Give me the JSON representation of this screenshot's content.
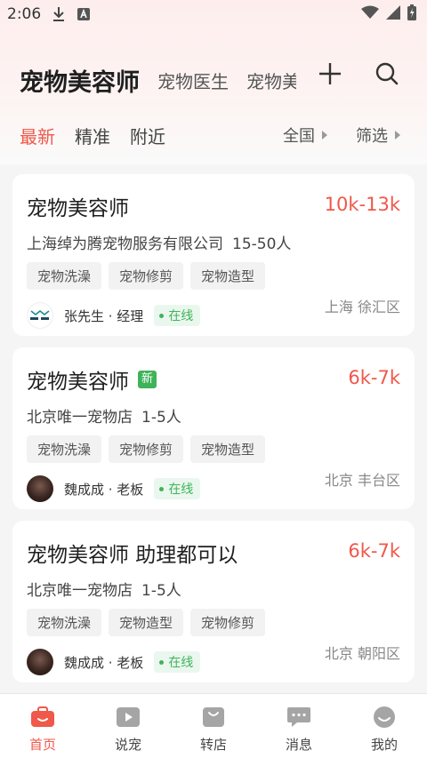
{
  "status_bar": {
    "time": "2:06"
  },
  "header": {
    "title": "宠物美容师",
    "tabs": [
      "宠物医生",
      "宠物美"
    ]
  },
  "filters": {
    "tabs": [
      "最新",
      "精准",
      "附近"
    ],
    "region": "全国",
    "filter": "筛选"
  },
  "jobs": [
    {
      "title": "宠物美容师",
      "is_new": false,
      "salary": "10k-13k",
      "company": "上海绰为腾宠物服务有限公司",
      "size": "15-50人",
      "tags": [
        "宠物洗澡",
        "宠物修剪",
        "宠物造型"
      ],
      "recruiter": "张先生 · 经理",
      "online": "在线",
      "location": "上海 徐汇区"
    },
    {
      "title": "宠物美容师",
      "is_new": true,
      "new_label": "新",
      "salary": "6k-7k",
      "company": "北京唯一宠物店",
      "size": "1-5人",
      "tags": [
        "宠物洗澡",
        "宠物修剪",
        "宠物造型"
      ],
      "recruiter": "魏成成 · 老板",
      "online": "在线",
      "location": "北京 丰台区"
    },
    {
      "title": "宠物美容师 助理都可以",
      "is_new": false,
      "salary": "6k-7k",
      "company": "北京唯一宠物店",
      "size": "1-5人",
      "tags": [
        "宠物洗澡",
        "宠物造型",
        "宠物修剪"
      ],
      "recruiter": "魏成成 · 老板",
      "online": "在线",
      "location": "北京 朝阳区"
    }
  ],
  "bottom_nav": [
    {
      "label": "首页",
      "icon": "home-briefcase-icon",
      "active": true
    },
    {
      "label": "说宠",
      "icon": "play-video-icon",
      "active": false
    },
    {
      "label": "转店",
      "icon": "shop-bag-icon",
      "active": false
    },
    {
      "label": "消息",
      "icon": "chat-bubble-icon",
      "active": false
    },
    {
      "label": "我的",
      "icon": "profile-face-icon",
      "active": false
    }
  ],
  "colors": {
    "accent": "#f0584a",
    "online_green": "#3fb35a"
  }
}
